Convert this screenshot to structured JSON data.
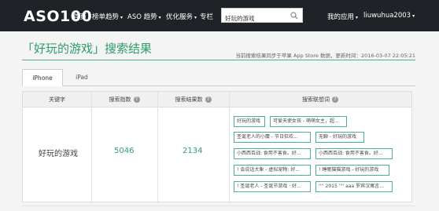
{
  "brand": {
    "logo": "ASO100"
  },
  "nav": {
    "items": [
      {
        "label": "首页",
        "caret": false
      },
      {
        "label": "榜单趋势",
        "caret": true
      },
      {
        "label": "ASO 趋势",
        "caret": true
      },
      {
        "label": "优化服务",
        "caret": true
      },
      {
        "label": "专栏",
        "caret": false
      }
    ]
  },
  "search": {
    "value": "好玩的游戏",
    "icon": "search-icon"
  },
  "user": {
    "my_apps": "我的应用",
    "username": "liuwuhua2003"
  },
  "page": {
    "title": "「好玩的游戏」搜索结果",
    "update_note": "当前搜索结果同步于苹果 App Store 数据，更新时间：2016-03-07 22:05:21"
  },
  "tabs": [
    {
      "label": "iPhone",
      "active": true
    },
    {
      "label": "iPad",
      "active": false
    }
  ],
  "table": {
    "headers": [
      "关键字",
      "搜索指数",
      "搜索结果数",
      "搜索联想词"
    ],
    "row": {
      "keyword": "好玩的游戏",
      "search_index": "5046",
      "result_count": "2134"
    },
    "suggestions": [
      "好玩的游戏",
      "可爱天使女孩 - 萌萌女主，超...",
      "圣诞老人的小麋 - 节日狂欢...",
      "无聊 - 好玩的游戏",
      "小西西百战: 食用不害食。好...",
      "小西西百战: 食用不害食。好...",
      "! 会说话大象 - 虚拟宠物: 好...",
      "! 睡眠猫猫游戏 - 好玩的游戏",
      "! 圣诞老人 - 圣诞节游戏 · 好...",
      "'''' 2015 '''' aaa 罗宾汉寓言..."
    ]
  },
  "colors": {
    "accent": "#2e9c6a",
    "topbar": "#1f2328"
  }
}
